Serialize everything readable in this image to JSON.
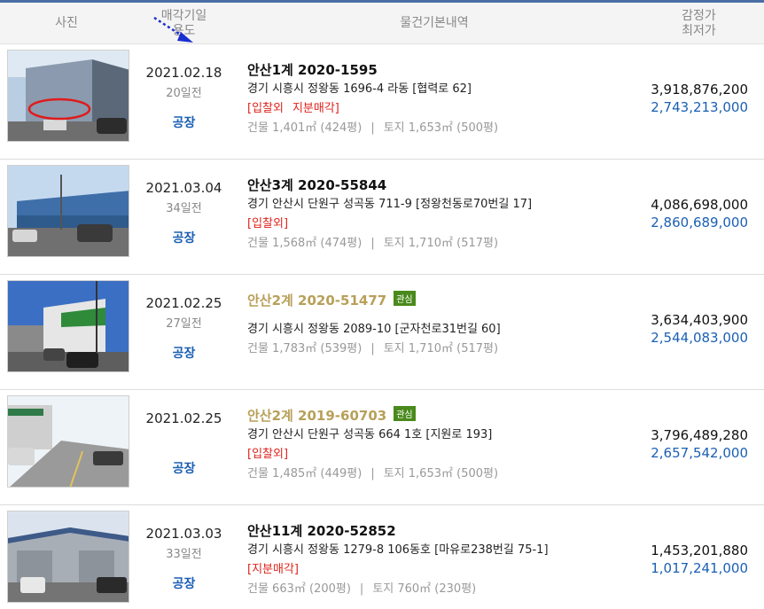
{
  "header": {
    "photo": "사진",
    "date_line1": "매각기일",
    "date_line2": "용도",
    "info": "물건기본내역",
    "price_line1": "감정가",
    "price_line2": "최저가"
  },
  "colors": {
    "accent": "#1a5fb4",
    "warning": "#e0221b",
    "interest_badge": "#4a8a1c",
    "gold_case": "#b8a05a"
  },
  "rows": [
    {
      "date": "2021.02.18",
      "days": "20일전",
      "use": "공장",
      "case": "안산1계 2020-1595",
      "badge": "",
      "address": "경기 시흥시 정왕동 1696-4 라동 [협력로 62]",
      "tag1": "[입찰외",
      "tag2": "지분매각]",
      "building": "건물 1,401㎡ (424평)",
      "land": "토지 1,653㎡ (500평)",
      "appraisal": "3,918,876,200",
      "minimum": "2,743,213,000"
    },
    {
      "date": "2021.03.04",
      "days": "34일전",
      "use": "공장",
      "case": "안산3계 2020-55844",
      "badge": "",
      "address": "경기 안산시 단원구 성곡동 711-9 [정왕천동로70번길 17]",
      "tag1": "[입찰외]",
      "tag2": "",
      "building": "건물 1,568㎡ (474평)",
      "land": "토지 1,710㎡ (517평)",
      "appraisal": "4,086,698,000",
      "minimum": "2,860,689,000"
    },
    {
      "date": "2021.02.25",
      "days": "27일전",
      "use": "공장",
      "case": "안산2계 2020-51477",
      "badge": "관심",
      "address": "경기 시흥시 정왕동 2089-10 [군자천로31번길 60]",
      "tag1": "",
      "tag2": "",
      "building": "건물 1,783㎡ (539평)",
      "land": "토지 1,710㎡ (517평)",
      "appraisal": "3,634,403,900",
      "minimum": "2,544,083,000"
    },
    {
      "date": "2021.02.25",
      "days": "",
      "use": "공장",
      "case": "안산2계 2019-60703",
      "badge": "관심",
      "address": "경기 안산시 단원구 성곡동 664 1호 [지원로 193]",
      "tag1": "[입찰외]",
      "tag2": "",
      "building": "건물 1,485㎡ (449평)",
      "land": "토지 1,653㎡ (500평)",
      "appraisal": "3,796,489,280",
      "minimum": "2,657,542,000"
    },
    {
      "date": "2021.03.03",
      "days": "33일전",
      "use": "공장",
      "case": "안산11계 2020-52852",
      "badge": "",
      "address": "경기 시흥시 정왕동 1279-8 106동호 [마유로238번길 75-1]",
      "tag1": "[지분매각]",
      "tag2": "",
      "building": "건물 663㎡ (200평)",
      "land": "토지 760㎡ (230평)",
      "appraisal": "1,453,201,880",
      "minimum": "1,017,241,000"
    }
  ]
}
